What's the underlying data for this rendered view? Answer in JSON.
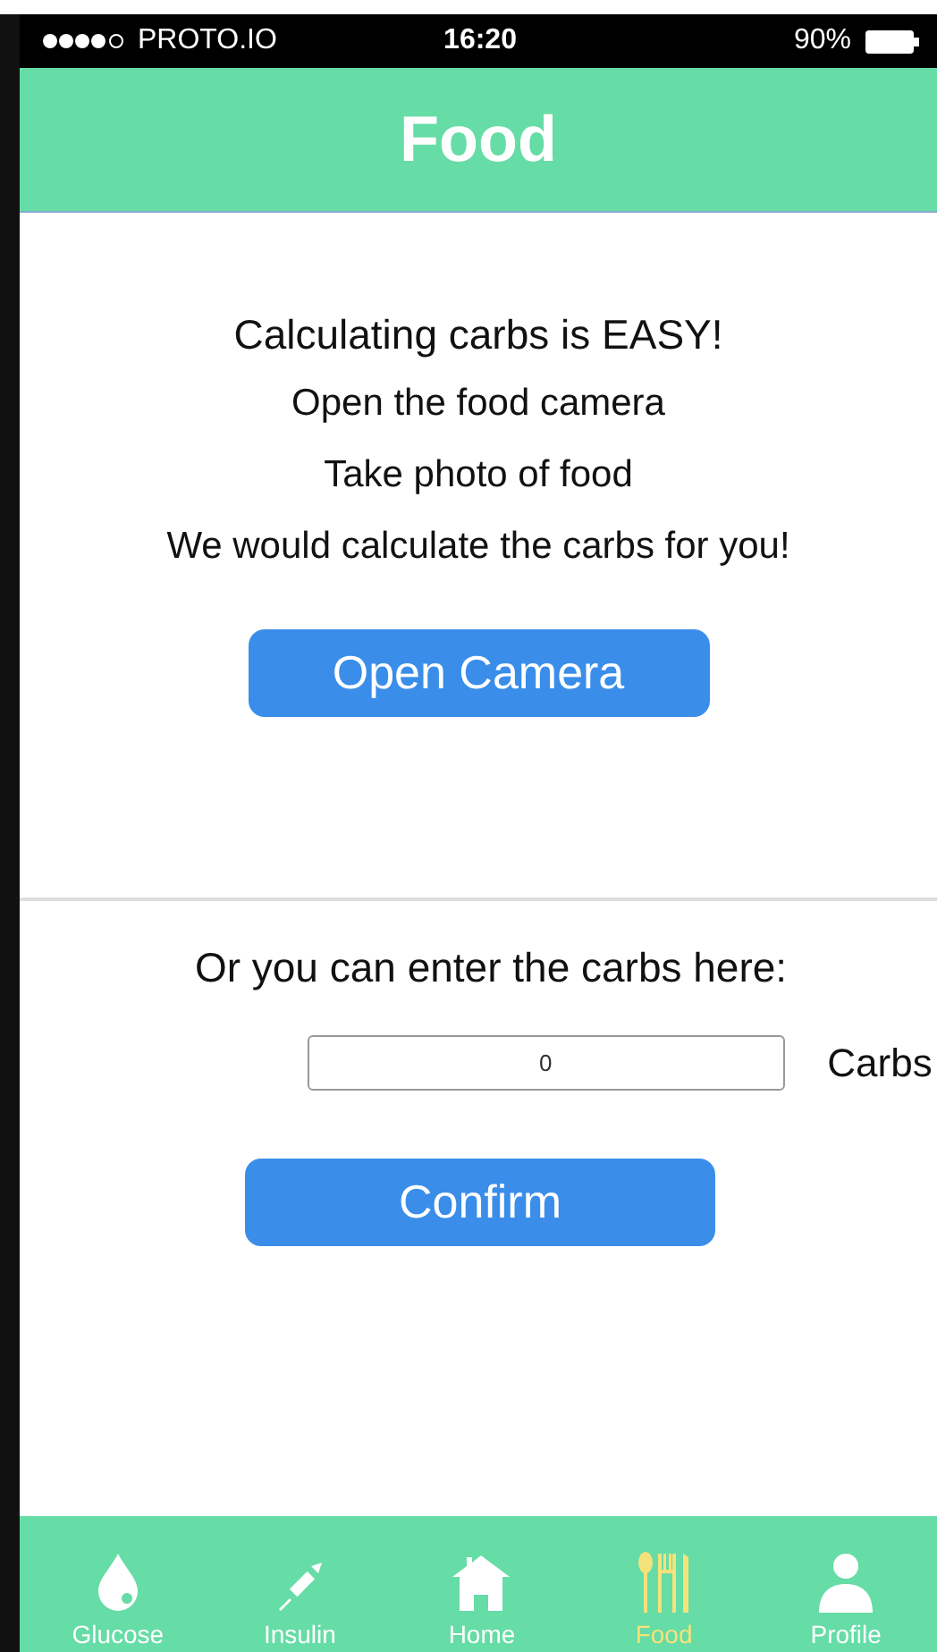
{
  "status_bar": {
    "carrier": "PROTO.IO",
    "time": "16:20",
    "battery": "90%"
  },
  "header": {
    "title": "Food"
  },
  "camera_section": {
    "heading": "Calculating carbs is EASY!",
    "lines": [
      "Open the food camera",
      "Take photo of food",
      "We would calculate the carbs for you!"
    ],
    "button": "Open Camera"
  },
  "manual_section": {
    "heading": "Or you can enter the carbs here:",
    "field": {
      "value": "0"
    },
    "unit": "Carbs",
    "button": "Confirm"
  },
  "tab_bar": [
    {
      "kind": "drop",
      "label": "Glucose",
      "selected": false
    },
    {
      "kind": "syringe",
      "label": "Insulin",
      "selected": false
    },
    {
      "kind": "home",
      "label": "Home",
      "selected": false
    },
    {
      "kind": "cutlery",
      "label": "Food",
      "selected": true
    },
    {
      "kind": "person",
      "label": "Profile",
      "selected": false
    }
  ]
}
